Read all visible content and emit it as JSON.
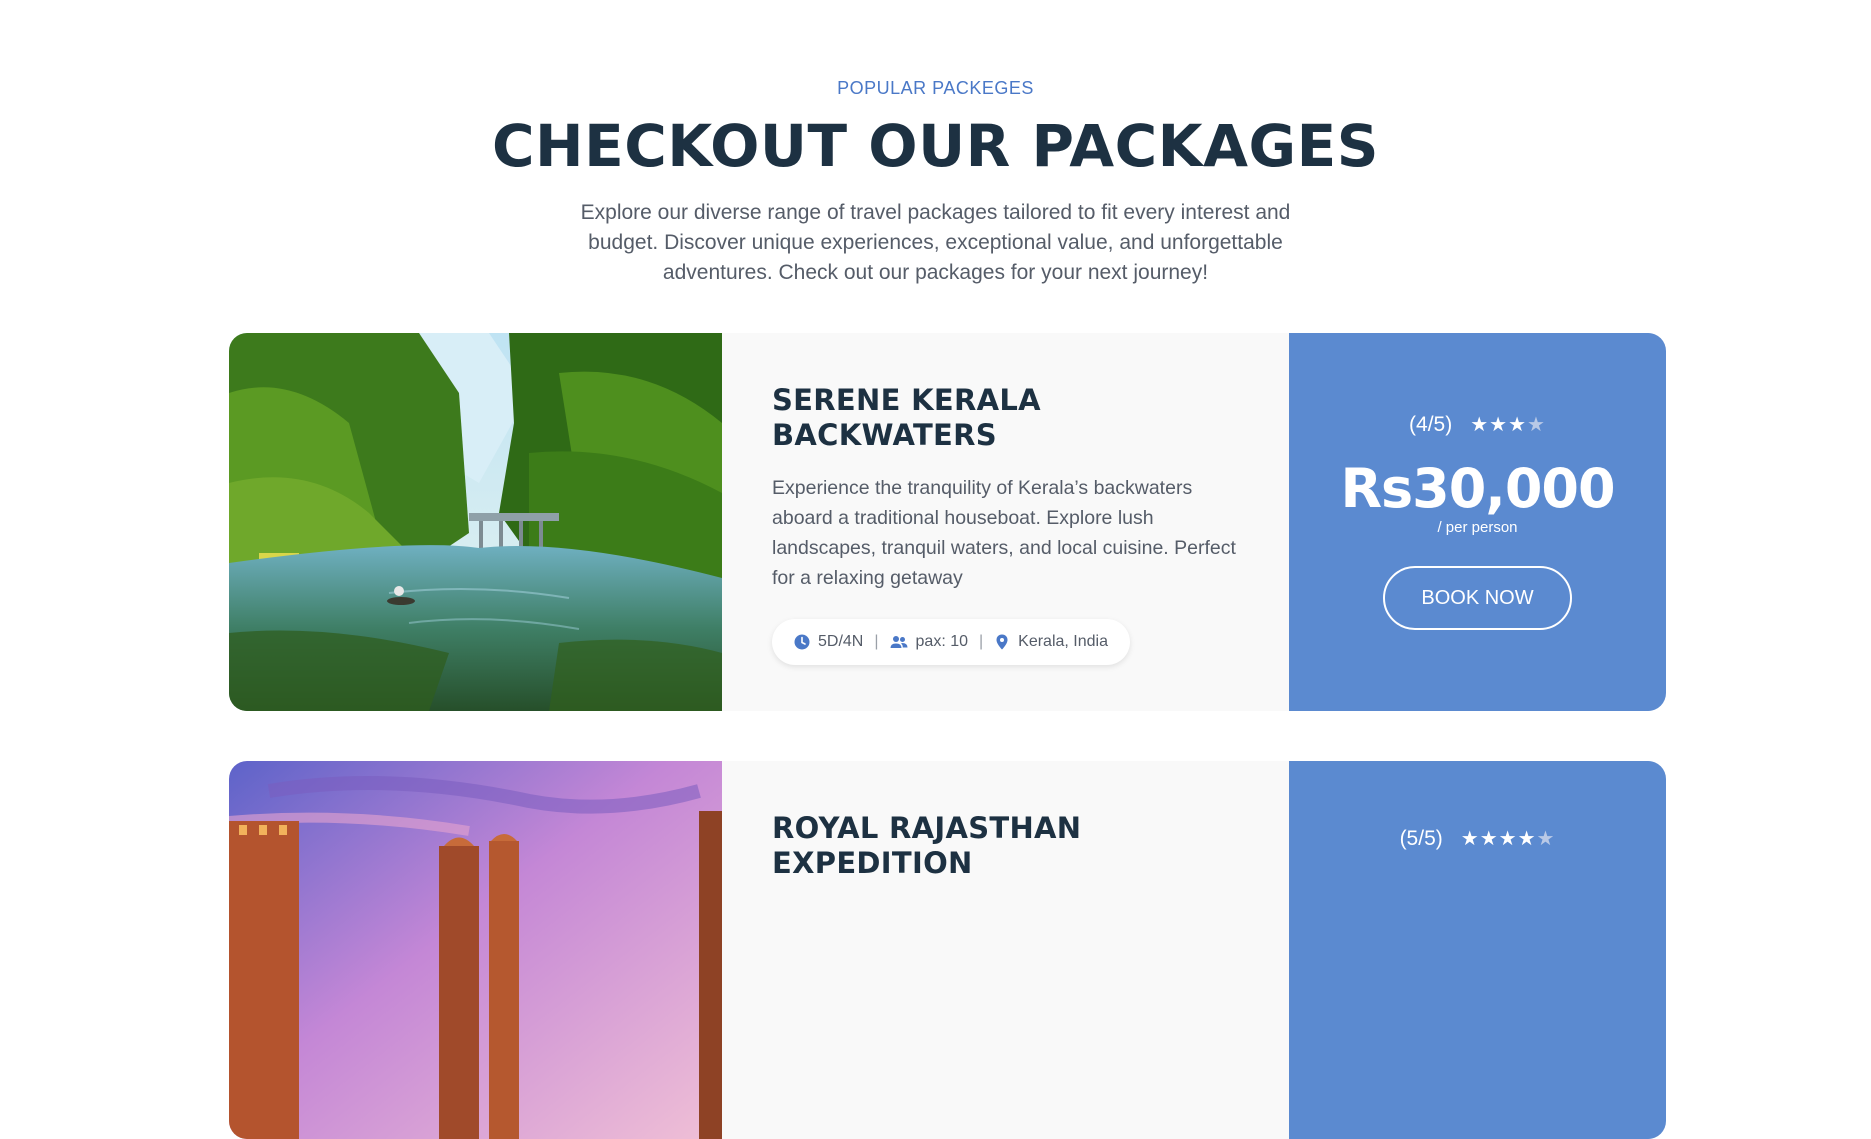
{
  "section": {
    "eyebrow": "POPULAR PACKEGES",
    "title": "CHECKOUT OUR PACKAGES",
    "description": "Explore our diverse range of travel packages tailored to fit every interest and budget. Discover unique experiences, exceptional value, and unforgettable adventures. Check out our packages for your next journey!"
  },
  "packages": [
    {
      "title": "SERENE KERALA BACKWATERS",
      "description": "Experience the tranquility of Kerala’s backwaters aboard a traditional houseboat. Explore lush landscapes, tranquil waters, and local cuisine. Perfect for a relaxing getaway",
      "duration": "5D/4N",
      "pax": "pax: 10",
      "location": "Kerala, India",
      "rating_text": "(4/5)",
      "rating": 4,
      "price": "Rs30,000",
      "per": "/ per person",
      "book_label": "BOOK NOW"
    },
    {
      "title": "ROYAL RAJASTHAN EXPEDITION",
      "rating_text": "(5/5)",
      "rating": 5
    }
  ],
  "icons": {
    "duration": "clock-icon",
    "pax": "users-icon",
    "location": "map-pin-icon",
    "star": "star-icon"
  },
  "colors": {
    "accent": "#5b8ad0",
    "eyebrow": "#4a78c7",
    "heading": "#1d3142",
    "body_text": "#555c68",
    "card_bg": "#f9f9f9"
  }
}
